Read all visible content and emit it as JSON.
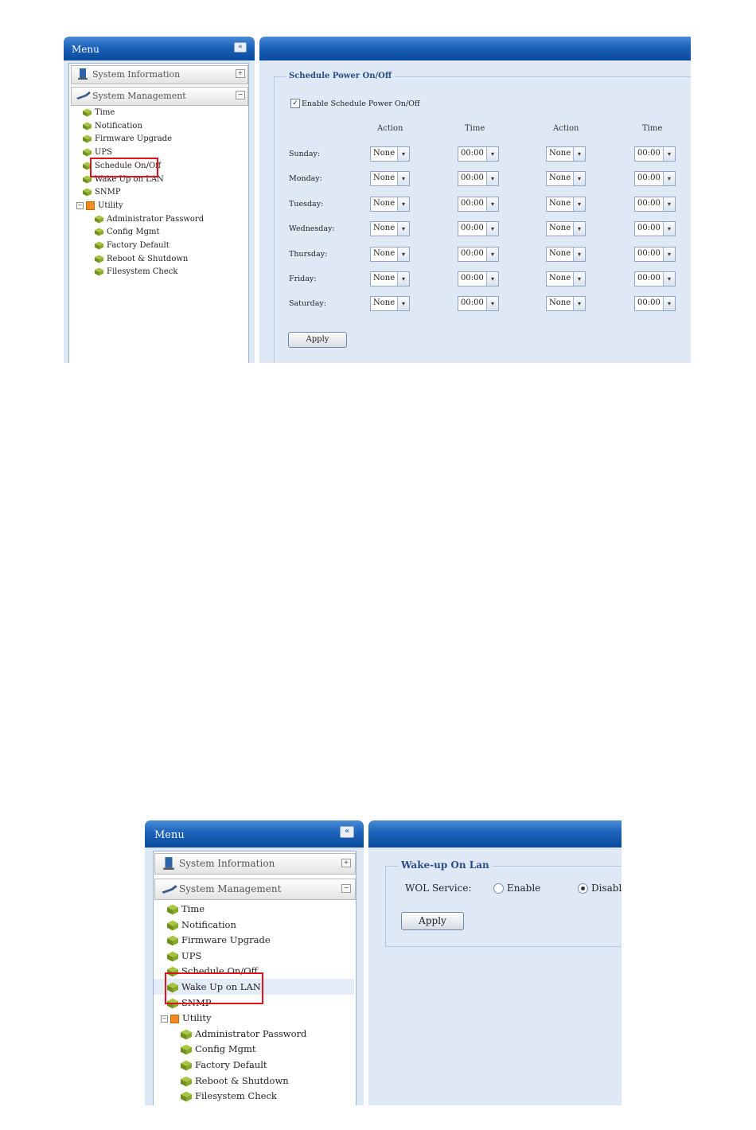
{
  "top": {
    "menu": {
      "title": "Menu",
      "collapse": "«",
      "groups": [
        {
          "label": "System Information",
          "toggle": "+",
          "icon": "monitor-icon"
        },
        {
          "label": "System Management",
          "toggle": "−",
          "icon": "wrench-icon"
        }
      ],
      "items": [
        "Time",
        "Notification",
        "Firmware Upgrade",
        "UPS",
        "Schedule On/Off",
        "Wake Up on LAN",
        "SNMP"
      ],
      "utility": {
        "label": "Utility",
        "toggle": "−",
        "items": [
          "Administrator Password",
          "Config Mgmt",
          "Factory Default",
          "Reboot & Shutdown",
          "Filesystem Check"
        ]
      }
    },
    "schedule": {
      "legend": "Schedule Power On/Off",
      "enable_label": "Enable Schedule Power On/Off",
      "enable_checked": true,
      "columns": [
        "Action",
        "Time",
        "Action",
        "Time"
      ],
      "rows": [
        {
          "day": "Sunday:",
          "a1": "None",
          "t1": "00:00",
          "a2": "None",
          "t2": "00:00"
        },
        {
          "day": "Monday:",
          "a1": "None",
          "t1": "00:00",
          "a2": "None",
          "t2": "00:00"
        },
        {
          "day": "Tuesday:",
          "a1": "None",
          "t1": "00:00",
          "a2": "None",
          "t2": "00:00"
        },
        {
          "day": "Wednesday:",
          "a1": "None",
          "t1": "00:00",
          "a2": "None",
          "t2": "00:00"
        },
        {
          "day": "Thursday:",
          "a1": "None",
          "t1": "00:00",
          "a2": "None",
          "t2": "00:00"
        },
        {
          "day": "Friday:",
          "a1": "None",
          "t1": "00:00",
          "a2": "None",
          "t2": "00:00"
        },
        {
          "day": "Saturday:",
          "a1": "None",
          "t1": "00:00",
          "a2": "None",
          "t2": "00:00"
        }
      ],
      "apply": "Apply"
    }
  },
  "bottom": {
    "menu": {
      "title": "Menu",
      "collapse": "«",
      "groups": [
        {
          "label": "System Information",
          "toggle": "+",
          "icon": "monitor-icon"
        },
        {
          "label": "System Management",
          "toggle": "−",
          "icon": "wrench-icon"
        }
      ],
      "items": [
        "Time",
        "Notification",
        "Firmware Upgrade",
        "UPS",
        "Schedule On/Off",
        "Wake Up on LAN",
        "SNMP"
      ],
      "utility": {
        "label": "Utility",
        "toggle": "−",
        "items": [
          "Administrator Password",
          "Config Mgmt",
          "Factory Default",
          "Reboot & Shutdown",
          "Filesystem Check"
        ]
      }
    },
    "wol": {
      "legend": "Wake-up On Lan",
      "service_label": "WOL Service:",
      "enable": "Enable",
      "disable": "Disable",
      "selected": "Disable",
      "apply": "Apply"
    }
  },
  "colors": {
    "header_blue": "#1b62b9",
    "highlight_red": "#e0121b",
    "content_bg": "#dfe9f6",
    "legend_text": "#2a4d85"
  }
}
